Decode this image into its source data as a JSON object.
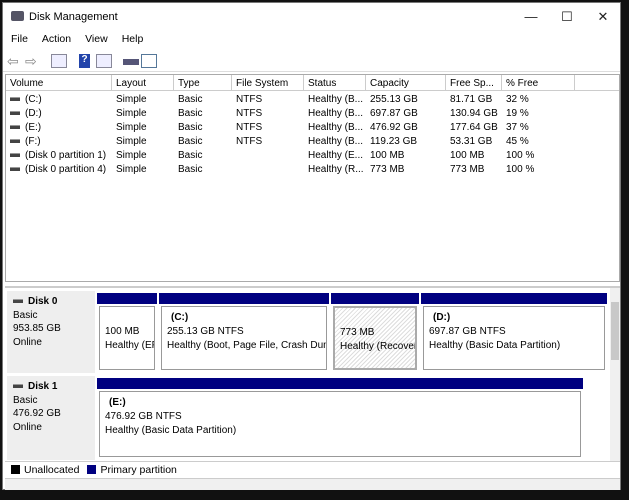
{
  "window": {
    "title": "Disk Management",
    "minimize": "—",
    "maximize": "☐",
    "close": "✕"
  },
  "menu": [
    "File",
    "Action",
    "View",
    "Help"
  ],
  "toolbar": [
    "back-icon",
    "forward-icon",
    "console-tree-icon",
    "help-icon",
    "action-pane-icon",
    "rescan-disk-icon",
    "properties-icon"
  ],
  "table": {
    "columns": [
      "Volume",
      "Layout",
      "Type",
      "File System",
      "Status",
      "Capacity",
      "Free Sp...",
      "% Free"
    ],
    "rows": [
      [
        "(C:)",
        "Simple",
        "Basic",
        "NTFS",
        "Healthy (B...",
        "255.13 GB",
        "81.71 GB",
        "32 %"
      ],
      [
        "(D:)",
        "Simple",
        "Basic",
        "NTFS",
        "Healthy (B...",
        "697.87 GB",
        "130.94 GB",
        "19 %"
      ],
      [
        "(E:)",
        "Simple",
        "Basic",
        "NTFS",
        "Healthy (B...",
        "476.92 GB",
        "177.64 GB",
        "37 %"
      ],
      [
        "(F:)",
        "Simple",
        "Basic",
        "NTFS",
        "Healthy (B...",
        "119.23 GB",
        "53.31 GB",
        "45 %"
      ],
      [
        "(Disk 0 partition 1)",
        "Simple",
        "Basic",
        "",
        "Healthy (E...",
        "100 MB",
        "100 MB",
        "100 %"
      ],
      [
        "(Disk 0 partition 4)",
        "Simple",
        "Basic",
        "",
        "Healthy (R...",
        "773 MB",
        "773 MB",
        "100 %"
      ]
    ]
  },
  "disks": [
    {
      "name": "Disk 0",
      "type": "Basic",
      "size": "953.85 GB",
      "state": "Online",
      "partitions": [
        {
          "label": "",
          "size": "100 MB",
          "status": "Healthy (EF"
        },
        {
          "label": "(C:)",
          "size": "255.13 GB NTFS",
          "status": "Healthy (Boot, Page File, Crash Dum"
        },
        {
          "label": "",
          "size": "773 MB",
          "status": "Healthy (Recovery"
        },
        {
          "label": "(D:)",
          "size": "697.87 GB NTFS",
          "status": "Healthy (Basic Data Partition)"
        }
      ]
    },
    {
      "name": "Disk 1",
      "type": "Basic",
      "size": "476.92 GB",
      "state": "Online",
      "partitions": [
        {
          "label": "(E:)",
          "size": "476.92 GB NTFS",
          "status": "Healthy (Basic Data Partition)"
        }
      ]
    }
  ],
  "legend": [
    {
      "label": "Unallocated",
      "color": "#000000"
    },
    {
      "label": "Primary partition",
      "color": "#000080"
    }
  ]
}
